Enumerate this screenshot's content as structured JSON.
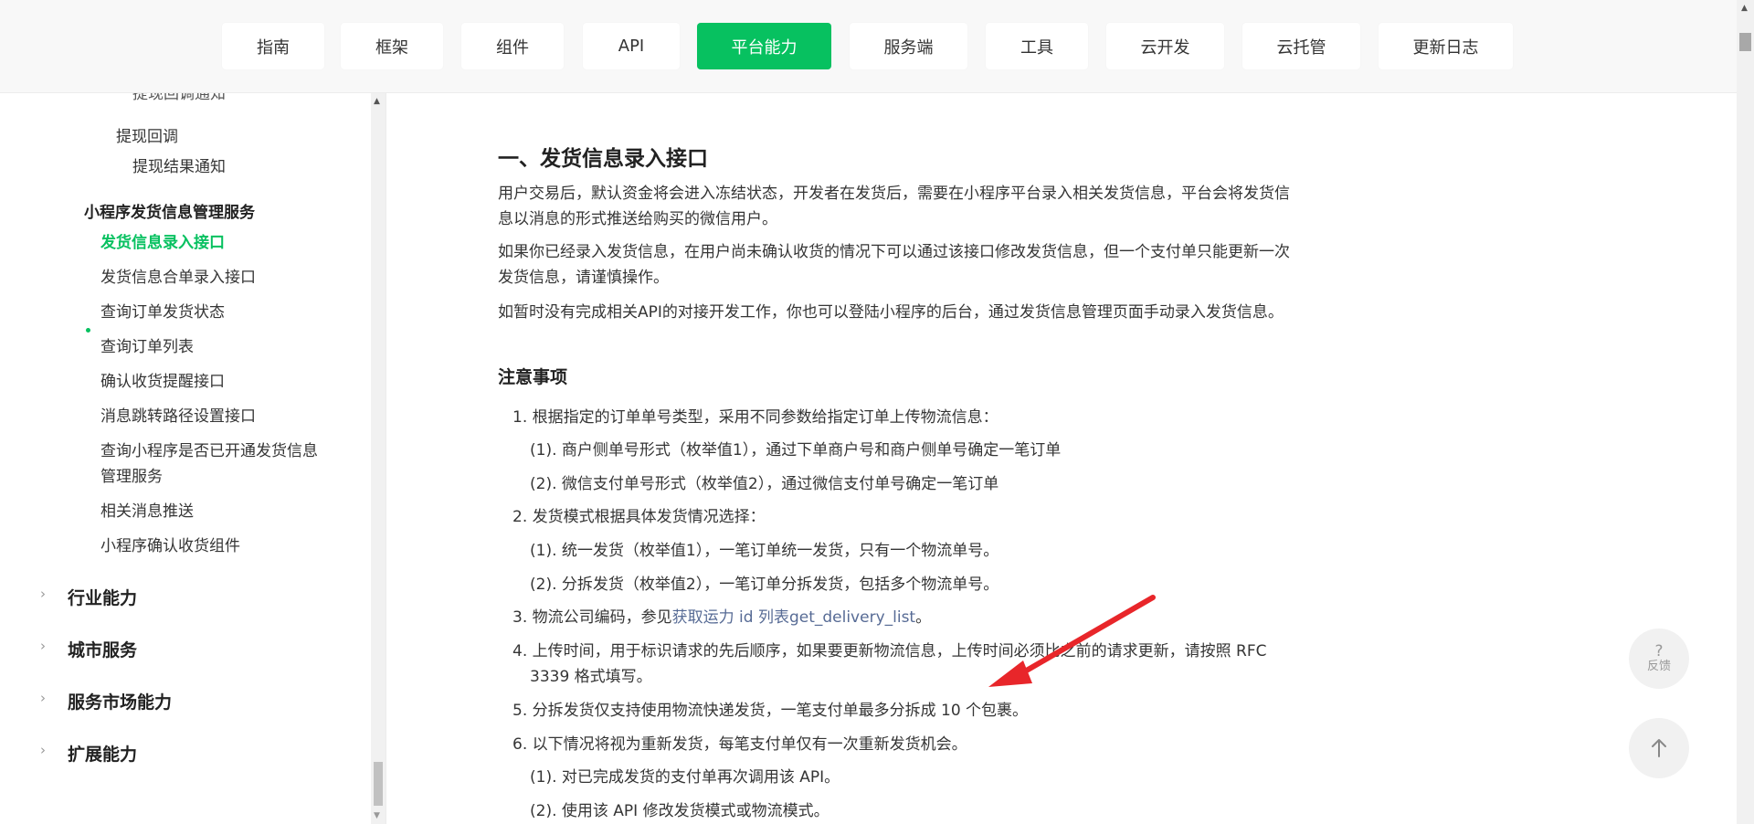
{
  "nav": {
    "tabs": [
      {
        "label": "指南"
      },
      {
        "label": "框架"
      },
      {
        "label": "组件"
      },
      {
        "label": "API"
      },
      {
        "label": "平台能力"
      },
      {
        "label": "服务端"
      },
      {
        "label": "工具"
      },
      {
        "label": "云开发"
      },
      {
        "label": "云托管"
      },
      {
        "label": "更新日志"
      }
    ],
    "active": "平台能力"
  },
  "sidebar": {
    "cut_top": "提现回调通知",
    "items": [
      "提现回调",
      "提现结果通知",
      "小程序发货信息管理服务",
      "发货信息录入接口",
      "发货信息合单录入接口",
      "查询订单发货状态",
      "查询订单列表",
      "确认收货提醒接口",
      "消息跳转路径设置接口",
      "查询小程序是否已开通发货信息",
      "管理服务",
      "相关消息推送",
      "小程序确认收货组件"
    ],
    "sections": [
      "行业能力",
      "城市服务",
      "服务市场能力",
      "扩展能力"
    ],
    "accent": "#07c160"
  },
  "main": {
    "title": "一、发货信息录入接口",
    "p1": [
      "用户交易后，默认资金将会进入冻结状态，开发者在发货后，需要在小程序平台录入相关发货信息，平台会将发货信",
      "息以消息的形式推送给购买的微信用户。"
    ],
    "p2": [
      "如果你已经录入发货信息，在用户尚未确认收货的情况下可以通过该接口修改发货信息，但一个支付单只能更新一次",
      "发货信息，请谨慎操作。"
    ],
    "p3": "如暂时没有完成相关API的对接开发工作，你也可以登陆小程序的后台，通过发货信息管理页面手动录入发货信息。",
    "notes_title": "注意事项",
    "list": [
      "1. 根据指定的订单单号类型，采用不同参数给指定订单上传物流信息：",
      "(1). 商户侧单号形式（枚举值1），通过下单商户号和商户侧单号确定一笔订单",
      "(2). 微信支付单号形式（枚举值2），通过微信支付单号确定一笔订单",
      "2. 发货模式根据具体发货情况选择：",
      "(1). 统一发货（枚举值1），一笔订单统一发货，只有一个物流单号。",
      "(2). 分拆发货（枚举值2），一笔订单分拆发货，包括多个物流单号。",
      "3. 物流公司编码，参见",
      "获取运力 id 列表get_delivery_list",
      "。",
      "4. 上传时间，用于标识请求的先后顺序，如果要更新物流信息，上传时间必须比之前的请求更新，请按照 RFC",
      "3339 格式填写。",
      "5. 分拆发货仅支持使用物流快递发货，一笔支付单最多分拆成 10 个包裹。",
      "6. 以下情况将视为重新发货，每笔支付单仅有一次重新发货机会。",
      "(1). 对已完成发货的支付单再次调用该 API。",
      "(2). 使用该 API 修改发货模式或物流模式。"
    ]
  },
  "float": {
    "feedback_q": "?",
    "feedback_label": "反馈",
    "top_icon": "arrow-up-icon"
  },
  "annotation": {
    "arrow_color": "#e8262a"
  }
}
